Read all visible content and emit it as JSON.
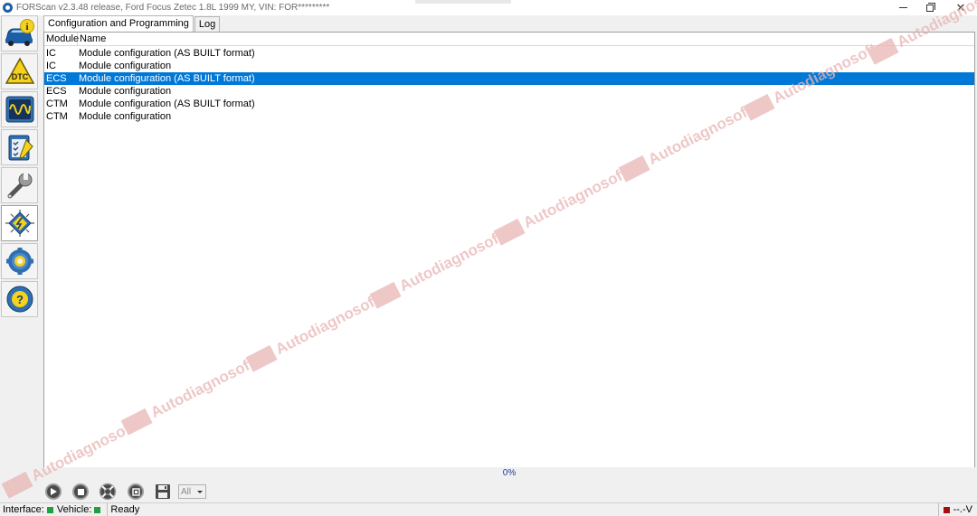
{
  "window": {
    "title": "FORScan v2.3.48 release, Ford Focus Zetec 1.8L 1999 MY, VIN: FOR*********"
  },
  "sidebar": {
    "items": [
      {
        "name": "vehicle-info-icon"
      },
      {
        "name": "dtc-icon",
        "label": "DTC"
      },
      {
        "name": "oscilloscope-icon"
      },
      {
        "name": "tests-checklist-icon"
      },
      {
        "name": "service-wrench-icon"
      },
      {
        "name": "configuration-chip-icon"
      },
      {
        "name": "settings-gear-icon"
      },
      {
        "name": "help-icon",
        "label": "?"
      }
    ]
  },
  "tabs": [
    {
      "label": "Configuration and Programming",
      "active": true
    },
    {
      "label": "Log",
      "active": false
    }
  ],
  "table": {
    "columns": [
      "Module",
      "Name"
    ],
    "rows": [
      {
        "module": "IC",
        "name": "Module configuration (AS BUILT format)",
        "selected": false
      },
      {
        "module": "IC",
        "name": "Module configuration",
        "selected": false
      },
      {
        "module": "ECS",
        "name": "Module configuration (AS BUILT format)",
        "selected": true
      },
      {
        "module": "ECS",
        "name": "Module configuration",
        "selected": false
      },
      {
        "module": "CTM",
        "name": "Module configuration (AS BUILT format)",
        "selected": false
      },
      {
        "module": "CTM",
        "name": "Module configuration",
        "selected": false
      }
    ]
  },
  "watermark": {
    "text": "Autodiagnosoft"
  },
  "progress": {
    "text": "0%",
    "value": 0
  },
  "toolbar": {
    "buttons": [
      "play-icon",
      "stop-icon",
      "lifebuoy-icon",
      "write-icon",
      "save-icon"
    ],
    "filter_value": "All"
  },
  "status": {
    "interface_label": "Interface:",
    "vehicle_label": "Vehicle:",
    "state": "Ready",
    "voltage": "--.-V"
  },
  "colors": {
    "selection": "#0078d7",
    "watermark": "#e8b4b4",
    "led_ok": "#20a040",
    "led_alert": "#a01010"
  }
}
